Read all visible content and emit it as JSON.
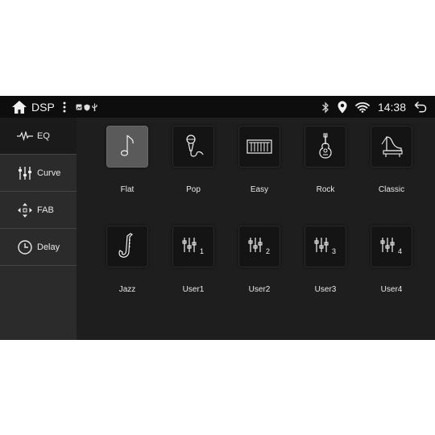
{
  "statusbar": {
    "title": "DSP",
    "time": "14:38",
    "icons": [
      "home-icon",
      "more-vert-icon",
      "gallery-notif-icon",
      "shield-notif-icon",
      "usb-notif-icon",
      "bluetooth-icon",
      "location-icon",
      "wifi-icon",
      "back-icon"
    ]
  },
  "sidebar": {
    "items": [
      {
        "label": "EQ",
        "icon": "waveform-icon",
        "active": true
      },
      {
        "label": "Curve",
        "icon": "sliders-icon",
        "active": false
      },
      {
        "label": "FAB",
        "icon": "fader-arrows-icon",
        "active": false
      },
      {
        "label": "Delay",
        "icon": "clock-icon",
        "active": false
      }
    ]
  },
  "presets": [
    {
      "label": "Flat",
      "icon": "music-note-icon",
      "selected": true
    },
    {
      "label": "Pop",
      "icon": "microphone-icon",
      "selected": false
    },
    {
      "label": "Easy",
      "icon": "keyboard-icon",
      "selected": false
    },
    {
      "label": "Rock",
      "icon": "guitar-icon",
      "selected": false
    },
    {
      "label": "Classic",
      "icon": "piano-icon",
      "selected": false
    },
    {
      "label": "Jazz",
      "icon": "saxophone-icon",
      "selected": false
    },
    {
      "label": "User1",
      "icon": "user-eq-icon",
      "num": "1",
      "selected": false
    },
    {
      "label": "User2",
      "icon": "user-eq-icon",
      "num": "2",
      "selected": false
    },
    {
      "label": "User3",
      "icon": "user-eq-icon",
      "num": "3",
      "selected": false
    },
    {
      "label": "User4",
      "icon": "user-eq-icon",
      "num": "4",
      "selected": false
    }
  ],
  "colors": {
    "background": "#1e1e1e",
    "sidebar": "#2b2b2b",
    "statusbar": "#0d0d0d",
    "selected_tile": "#5a5a5a",
    "text": "#e8e8e8"
  }
}
